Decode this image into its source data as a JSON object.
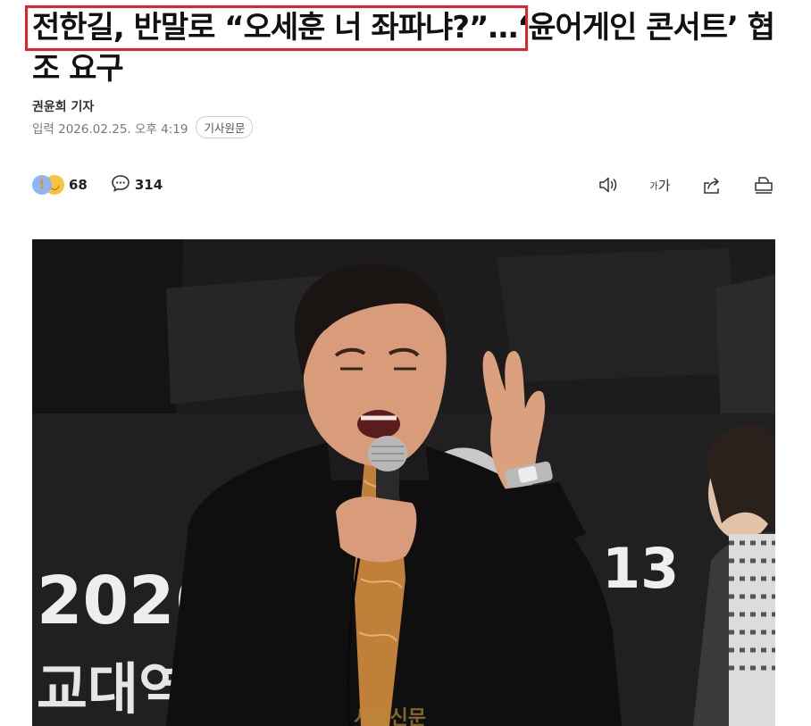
{
  "article": {
    "title": "전한길, 반말로 “오세훈 너 좌파냐?”…‘윤어게인 콘서트’ 협조 요구",
    "reporter": "권윤희 기자",
    "date": "입력 2026.02.25. 오후 4:19",
    "origin_label": "기사원문"
  },
  "toolbar": {
    "reaction_count": "68",
    "comment_count": "314",
    "font_small": "가",
    "font_large": "가"
  },
  "photo": {
    "banner_left_number": "2026",
    "banner_right_number": "13",
    "banner_bottom_text": "교대역",
    "watermark": "서울신문"
  },
  "colors": {
    "highlight": "#e8202a"
  },
  "icons": [
    "speaker-icon",
    "font-size-icon",
    "share-icon",
    "print-icon",
    "comment-icon"
  ]
}
